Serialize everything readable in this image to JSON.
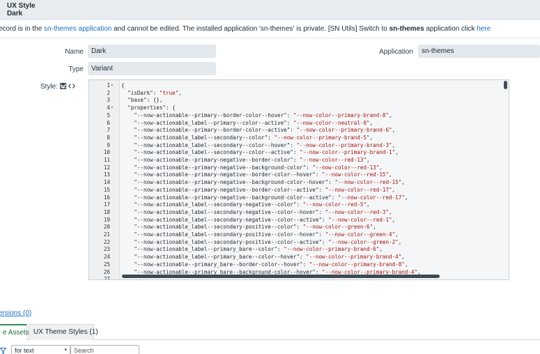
{
  "header": {
    "table_label": "UX Style",
    "record_name": "Dark"
  },
  "notice": {
    "part1": "ecord is in the ",
    "app_link": "sn-themes application",
    "part2": " and cannot be edited. The installed application 'sn-themes' is private.  [SN Utils] Switch to ",
    "app_name": "sn-themes",
    "part3": " application click ",
    "here_link": "here"
  },
  "form": {
    "name_label": "Name",
    "name_value": "Dark",
    "application_label": "Application",
    "application_value": "sn-themes",
    "type_label": "Type",
    "type_value": "Variant",
    "style_label": "Style:"
  },
  "editor": {
    "lines": [
      {
        "n": "1",
        "fold": true,
        "k": "{",
        "v": "",
        "e": ""
      },
      {
        "n": "2",
        "fold": false,
        "k": "  \"isDark\": ",
        "v": "\"true\"",
        "e": ","
      },
      {
        "n": "3",
        "fold": false,
        "k": "  \"base\": {},",
        "v": "",
        "e": ""
      },
      {
        "n": "4",
        "fold": true,
        "k": "  \"properties\": {",
        "v": "",
        "e": ""
      },
      {
        "n": "5",
        "fold": false,
        "k": "    \"--now-actionable--primary--border-color--hover\": ",
        "v": "\"--now-color--primary-brand-8\"",
        "e": ","
      },
      {
        "n": "6",
        "fold": false,
        "k": "    \"--now-actionable_label--primary--color--active\": ",
        "v": "\"--now-color--neutral-0\"",
        "e": ","
      },
      {
        "n": "7",
        "fold": false,
        "k": "    \"--now-actionable--primary--border-color--active\": ",
        "v": "\"--now-color--primary-brand-6\"",
        "e": ","
      },
      {
        "n": "8",
        "fold": false,
        "k": "    \"--now-actionable_label--secondary--color\": ",
        "v": "\"--now-color--primary-brand-5\"",
        "e": ","
      },
      {
        "n": "9",
        "fold": false,
        "k": "    \"--now-actionable_label--secondary--color--hover\": ",
        "v": "\"--now-color--primary-brand-3\"",
        "e": ","
      },
      {
        "n": "10",
        "fold": false,
        "k": "    \"--now-actionable_label--secondary--color--active\": ",
        "v": "\"--now-color--primary-brand-1\"",
        "e": ","
      },
      {
        "n": "11",
        "fold": false,
        "k": "    \"--now-actionable--primary-negative--border-color\": ",
        "v": "\"--now-color--red-13\"",
        "e": ","
      },
      {
        "n": "12",
        "fold": false,
        "k": "    \"--now-actionable--primary-negative--background-color\": ",
        "v": "\"--now-color--red-13\"",
        "e": ","
      },
      {
        "n": "13",
        "fold": false,
        "k": "    \"--now-actionable--primary-negative--border-color--hover\": ",
        "v": "\"--now-color--red-15\"",
        "e": ","
      },
      {
        "n": "14",
        "fold": false,
        "k": "    \"--now-actionable--primary-negative--background-color--hover\": ",
        "v": "\"--now-color--red-15\"",
        "e": ","
      },
      {
        "n": "15",
        "fold": false,
        "k": "    \"--now-actionable--primary-negative--border-color--active\": ",
        "v": "\"--now-color--red-17\"",
        "e": ","
      },
      {
        "n": "16",
        "fold": false,
        "k": "    \"--now-actionable--primary-negative--background-color--active\": ",
        "v": "\"--now-color--red-17\"",
        "e": ","
      },
      {
        "n": "17",
        "fold": false,
        "k": "    \"--now-actionable_label--secondary-negative--color\": ",
        "v": "\"--now-color--red-5\"",
        "e": ","
      },
      {
        "n": "18",
        "fold": false,
        "k": "    \"--now-actionable_label--secondary-negative--color--hover\": ",
        "v": "\"--now-color--red-3\"",
        "e": ","
      },
      {
        "n": "19",
        "fold": false,
        "k": "    \"--now-actionable_label--secondary-negative--color--active\": ",
        "v": "\"--now-color--red-1\"",
        "e": ","
      },
      {
        "n": "20",
        "fold": false,
        "k": "    \"--now-actionable_label--secondary-positive--color\": ",
        "v": "\"--now-color--green-6\"",
        "e": ","
      },
      {
        "n": "21",
        "fold": false,
        "k": "    \"--now-actionable_label--secondary-positive--color--hover\": ",
        "v": "\"--now-color--green-4\"",
        "e": ","
      },
      {
        "n": "22",
        "fold": false,
        "k": "    \"--now-actionable_label--secondary-positive--color--active\": ",
        "v": "\"--now-color--green-2\"",
        "e": ","
      },
      {
        "n": "23",
        "fold": false,
        "k": "    \"--now-actionable_label--primary_bare--color\": ",
        "v": "\"--now-color--primary-brand-6\"",
        "e": ","
      },
      {
        "n": "24",
        "fold": false,
        "k": "    \"--now-actionable_label--primary_bare--color--hover\": ",
        "v": "\"--now-color--primary-brand-4\"",
        "e": ","
      },
      {
        "n": "25",
        "fold": false,
        "k": "    \"--now-actionable--primary_bare--border-color--hover\": ",
        "v": "\"--now-color--primary-brand-8\"",
        "e": ","
      },
      {
        "n": "26",
        "fold": false,
        "k": "    \"--now-actionable--primary_bare--background-color--hover\": ",
        "v": "\"--now-color--primary-brand-4\"",
        "e": ","
      },
      {
        "n": "27",
        "fold": false,
        "k": "",
        "v": "",
        "e": ""
      }
    ]
  },
  "related": {
    "versions_link": "ersions (0)",
    "tab_assets": "e Assets",
    "tab_theme_styles": "UX Theme Styles (1)",
    "filter_select_value": "for text",
    "search_placeholder": "Search"
  },
  "icons": {
    "fold": "chevron-down-icon",
    "save": "save-icon",
    "code": "code-icon",
    "filter": "filter-icon"
  },
  "colors": {
    "link": "#1f6fb8",
    "string_value": "#a31515",
    "active_tab": "#2e8b57",
    "field_bg": "#e3e8ec"
  }
}
